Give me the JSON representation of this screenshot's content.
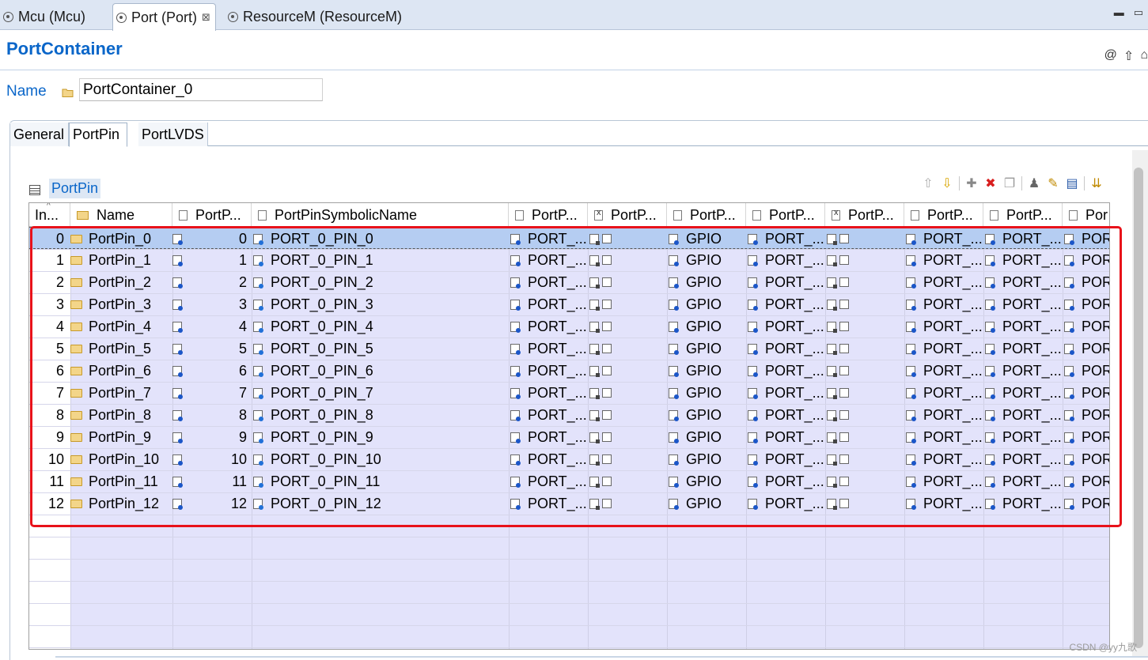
{
  "editor_tabs": [
    {
      "label": "Mcu (Mcu)",
      "active": false
    },
    {
      "label": "Port (Port)",
      "active": true,
      "close": "⊠"
    },
    {
      "label": "ResourceM (ResourceM)",
      "active": false
    }
  ],
  "form": {
    "title": "PortContainer",
    "name_label": "Name",
    "name_value": "PortContainer_0"
  },
  "sub_tabs": [
    "General",
    "PortPin",
    "PortLVDS"
  ],
  "section": {
    "title": "PortPin"
  },
  "table": {
    "columns": [
      "In...",
      "Name",
      "PortP...",
      "PortPinSymbolicName",
      "PortP...",
      "PortP...",
      "PortP...",
      "PortP...",
      "PortP...",
      "PortP...",
      "PortP...",
      "Por"
    ],
    "rows": [
      {
        "index": "0",
        "name": "PortPin_0",
        "id": "0",
        "symbolic": "PORT_0_PIN_0",
        "c4": "PORT_...",
        "c6": "GPIO",
        "c7": "PORT_...",
        "c9": "PORT_...",
        "c10": "PORT_...",
        "c11": "POR"
      },
      {
        "index": "1",
        "name": "PortPin_1",
        "id": "1",
        "symbolic": "PORT_0_PIN_1",
        "c4": "PORT_...",
        "c6": "GPIO",
        "c7": "PORT_...",
        "c9": "PORT_...",
        "c10": "PORT_...",
        "c11": "POR"
      },
      {
        "index": "2",
        "name": "PortPin_2",
        "id": "2",
        "symbolic": "PORT_0_PIN_2",
        "c4": "PORT_...",
        "c6": "GPIO",
        "c7": "PORT_...",
        "c9": "PORT_...",
        "c10": "PORT_...",
        "c11": "POR"
      },
      {
        "index": "3",
        "name": "PortPin_3",
        "id": "3",
        "symbolic": "PORT_0_PIN_3",
        "c4": "PORT_...",
        "c6": "GPIO",
        "c7": "PORT_...",
        "c9": "PORT_...",
        "c10": "PORT_...",
        "c11": "POR"
      },
      {
        "index": "4",
        "name": "PortPin_4",
        "id": "4",
        "symbolic": "PORT_0_PIN_4",
        "c4": "PORT_...",
        "c6": "GPIO",
        "c7": "PORT_...",
        "c9": "PORT_...",
        "c10": "PORT_...",
        "c11": "POR"
      },
      {
        "index": "5",
        "name": "PortPin_5",
        "id": "5",
        "symbolic": "PORT_0_PIN_5",
        "c4": "PORT_...",
        "c6": "GPIO",
        "c7": "PORT_...",
        "c9": "PORT_...",
        "c10": "PORT_...",
        "c11": "POR"
      },
      {
        "index": "6",
        "name": "PortPin_6",
        "id": "6",
        "symbolic": "PORT_0_PIN_6",
        "c4": "PORT_...",
        "c6": "GPIO",
        "c7": "PORT_...",
        "c9": "PORT_...",
        "c10": "PORT_...",
        "c11": "POR"
      },
      {
        "index": "7",
        "name": "PortPin_7",
        "id": "7",
        "symbolic": "PORT_0_PIN_7",
        "c4": "PORT_...",
        "c6": "GPIO",
        "c7": "PORT_...",
        "c9": "PORT_...",
        "c10": "PORT_...",
        "c11": "POR"
      },
      {
        "index": "8",
        "name": "PortPin_8",
        "id": "8",
        "symbolic": "PORT_0_PIN_8",
        "c4": "PORT_...",
        "c6": "GPIO",
        "c7": "PORT_...",
        "c9": "PORT_...",
        "c10": "PORT_...",
        "c11": "POR"
      },
      {
        "index": "9",
        "name": "PortPin_9",
        "id": "9",
        "symbolic": "PORT_0_PIN_9",
        "c4": "PORT_...",
        "c6": "GPIO",
        "c7": "PORT_...",
        "c9": "PORT_...",
        "c10": "PORT_...",
        "c11": "POR"
      },
      {
        "index": "10",
        "name": "PortPin_10",
        "id": "10",
        "symbolic": "PORT_0_PIN_10",
        "c4": "PORT_...",
        "c6": "GPIO",
        "c7": "PORT_...",
        "c9": "PORT_...",
        "c10": "PORT_...",
        "c11": "POR"
      },
      {
        "index": "11",
        "name": "PortPin_11",
        "id": "11",
        "symbolic": "PORT_0_PIN_11",
        "c4": "PORT_...",
        "c6": "GPIO",
        "c7": "PORT_...",
        "c9": "PORT_...",
        "c10": "PORT_...",
        "c11": "POR"
      },
      {
        "index": "12",
        "name": "PortPin_12",
        "id": "12",
        "symbolic": "PORT_0_PIN_12",
        "c4": "PORT_...",
        "c6": "GPIO",
        "c7": "PORT_...",
        "c9": "PORT_...",
        "c10": "PORT_...",
        "c11": "POR"
      }
    ],
    "selected_row": 0
  },
  "watermark": "CSDN @yy九歌",
  "colors": {
    "title": "#0a66c9",
    "row_fill": "#e3e3fb",
    "selected_row": "#b5cdf2",
    "highlight_box": "#e8121a"
  }
}
